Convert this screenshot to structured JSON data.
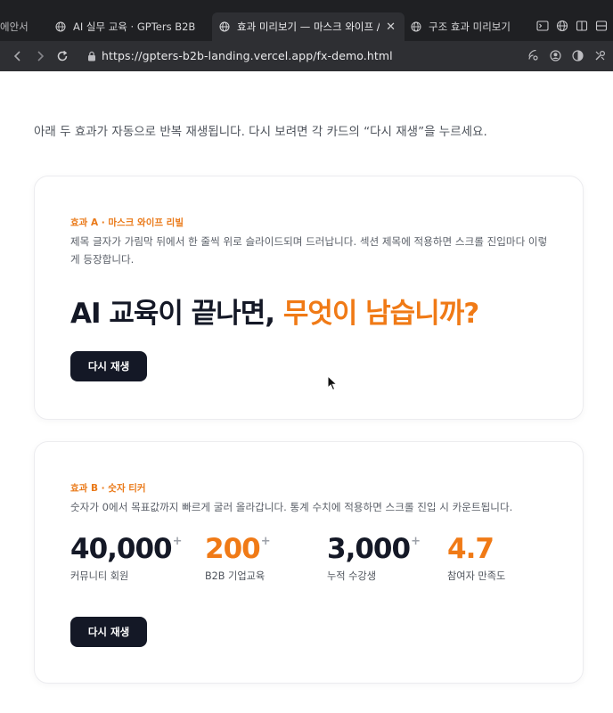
{
  "browser": {
    "tabs": [
      {
        "label": "에안서",
        "active": false
      },
      {
        "label": "AI 실무 교육 · GPTers B2B",
        "active": false
      },
      {
        "label": "효과 미리보기 — 마스크 와이프 /...",
        "active": true
      },
      {
        "label": "구조 효과 미리보기",
        "active": false
      }
    ],
    "url": "https://gpters-b2b-landing.vercel.app/fx-demo.html"
  },
  "page": {
    "intro": "아래 두 효과가 자동으로 반복 재생됩니다. 다시 보려면 각 카드의 “다시 재생”을 누르세요.",
    "card_a": {
      "eyebrow": "효과 A · 마스크 와이프 리빌",
      "description": "제목 글자가 가림막 뒤에서 한 줄씩 위로 슬라이드되며 드러납니다. 섹션 제목에 적용하면 스크롤 진입마다 이렇게 등장합니다.",
      "headline_main": "AI 교육이 끝나면, ",
      "headline_accent": "무엇이 남습니까?",
      "replay_label": "다시 재생"
    },
    "card_b": {
      "eyebrow": "효과 B · 숫자 티커",
      "description": "숫자가 0에서 목표값까지 빠르게 굴러 올라갑니다. 통계 수치에 적용하면 스크롤 진입 시 카운트됩니다.",
      "stats": [
        {
          "value": "40,000",
          "suffix": "+",
          "label": "커뮤니티 회원"
        },
        {
          "value": "200",
          "suffix": "+",
          "label": "B2B 기업교육"
        },
        {
          "value": "3,000",
          "suffix": "+",
          "label": "누적 수강생"
        },
        {
          "value": "4.7",
          "suffix": "",
          "label": "참여자 만족도"
        }
      ],
      "replay_label": "다시 재생"
    }
  },
  "colors": {
    "accent": "#f07a16",
    "dark": "#141826",
    "chrome": "#1f2023"
  }
}
